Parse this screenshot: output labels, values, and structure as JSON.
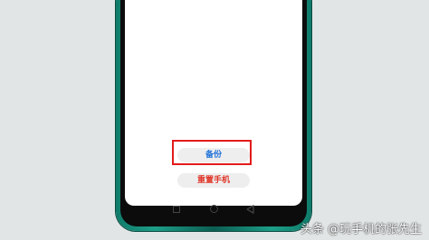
{
  "buttons": {
    "backup_label": "备份",
    "reset_label": "重置手机"
  },
  "watermark": {
    "text": "头条 @玩手机的张先生"
  },
  "colors": {
    "backup_text": "#1e6fd8",
    "reset_text": "#e0382b",
    "highlight_border": "#e31b1b",
    "phone_frame": "#0f7b6a"
  },
  "icons": {
    "nav": [
      "recent-apps-icon",
      "home-icon",
      "back-icon"
    ]
  }
}
